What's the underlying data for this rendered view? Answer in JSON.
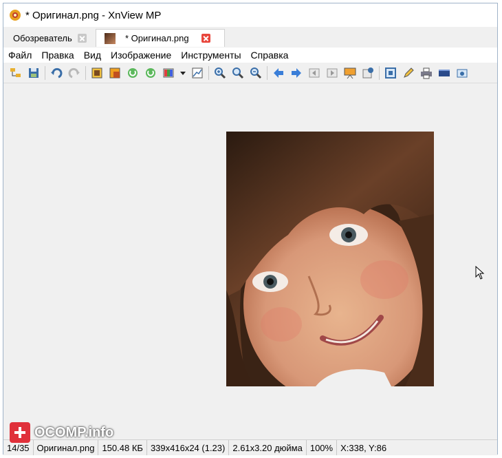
{
  "window": {
    "title": "* Оригинал.png - XnView MP"
  },
  "tabs": [
    {
      "label": "Обозреватель",
      "active": false
    },
    {
      "label": "* Оригинал.png",
      "active": true
    }
  ],
  "menu": [
    "Файл",
    "Правка",
    "Вид",
    "Изображение",
    "Инструменты",
    "Справка"
  ],
  "toolbar": {
    "icons": [
      "browser-icon",
      "save-icon",
      "undo-icon",
      "redo-icon",
      "crop-icon",
      "resize-icon",
      "rotate-left-icon",
      "rotate-right-icon",
      "adjust-icon",
      "dropdown-icon",
      "levels-icon",
      "zoom-in-icon",
      "zoom-fit-icon",
      "zoom-out-icon",
      "prev-icon",
      "next-icon",
      "first-icon",
      "last-icon",
      "slideshow-icon",
      "info-icon",
      "fullscreen-icon",
      "edit-icon",
      "print-icon",
      "scanner-icon",
      "capture-icon"
    ]
  },
  "status": {
    "index": "14/35",
    "filename": "Оригинал.png",
    "filesize": "150.48 КБ",
    "dimensions": "339x416x24 (1.23)",
    "print_size": "2.61x3.20 дюйма",
    "zoom": "100%",
    "coords": "X:338, Y:86"
  },
  "watermark": {
    "text": "OCOMP.info"
  }
}
